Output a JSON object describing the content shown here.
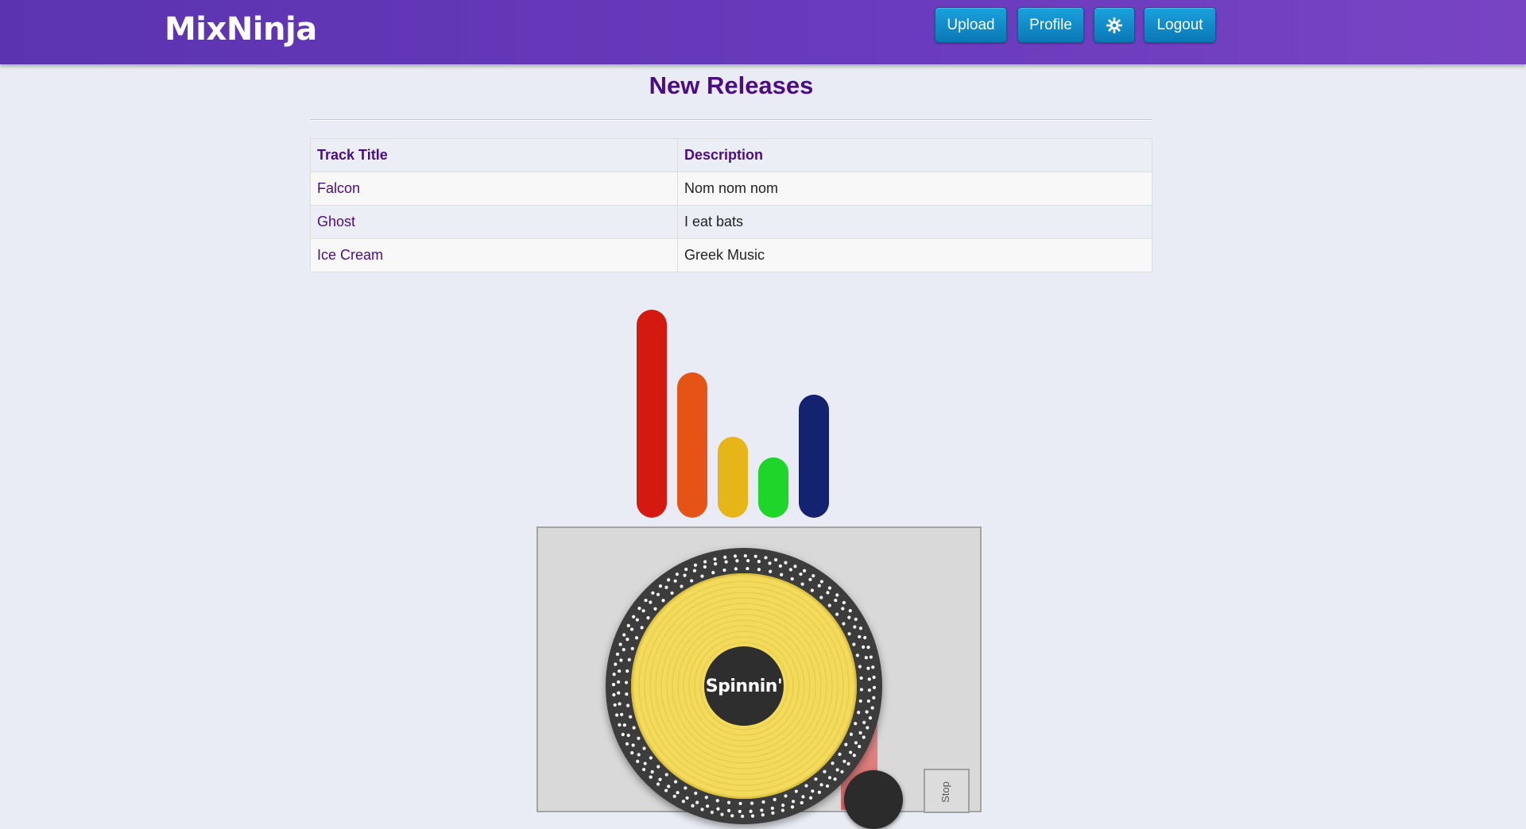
{
  "header": {
    "brand": "MixNinja",
    "buttons": {
      "upload": "Upload",
      "profile": "Profile",
      "settings_icon": "gear-icon",
      "logout": "Logout"
    }
  },
  "main": {
    "title": "New Releases",
    "table": {
      "columns": [
        "Track Title",
        "Description"
      ],
      "rows": [
        {
          "title": "Falcon",
          "description": "Nom nom nom"
        },
        {
          "title": "Ghost",
          "description": "I eat bats"
        },
        {
          "title": "Ice Cream",
          "description": "Greek Music"
        }
      ]
    }
  },
  "equalizer": {
    "levels": [
      1.0,
      0.7,
      0.39,
      0.29,
      0.59
    ],
    "colors": [
      "#d41a10",
      "#e55414",
      "#e6b517",
      "#1ed629",
      "#14236f"
    ]
  },
  "turntable": {
    "label": "Spinnin'",
    "stop_label": "Stop",
    "colors": {
      "record": "#f3da5a",
      "platter": "#3c3c3c",
      "deck": "#d9d9d9"
    }
  },
  "colors": {
    "header": "#6a3bbd",
    "accent": "#4b0d86",
    "button": "#1188c8"
  }
}
